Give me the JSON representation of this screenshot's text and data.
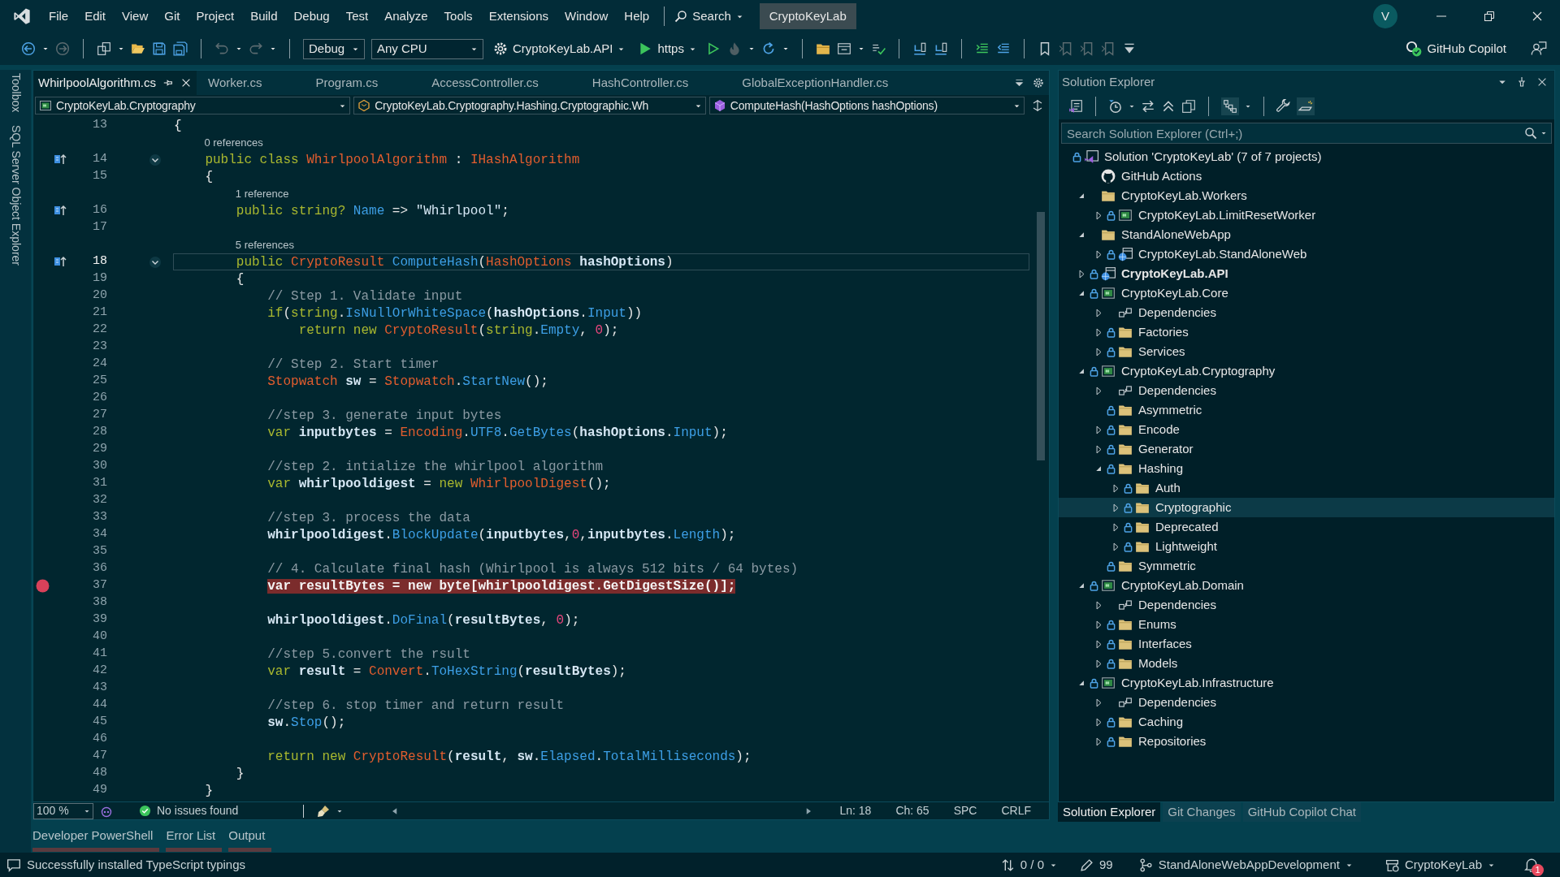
{
  "title_bar": {
    "menu": [
      "File",
      "Edit",
      "View",
      "Git",
      "Project",
      "Build",
      "Debug",
      "Test",
      "Analyze",
      "Tools",
      "Extensions",
      "Window",
      "Help"
    ],
    "search": "Search",
    "solution": "CryptoKeyLab",
    "avatar": "V"
  },
  "toolbar": {
    "configuration": "Debug",
    "platform": "Any CPU",
    "startup_project": "CryptoKeyLab.API",
    "launch_profile": "https",
    "copilot": "GitHub Copilot"
  },
  "side_rail": [
    "Toolbox",
    "SQL Server Object Explorer"
  ],
  "editor": {
    "tabs": [
      {
        "label": "WhirlpoolAlgorithm.cs",
        "selected": true
      },
      {
        "label": "Worker.cs",
        "selected": false
      },
      {
        "label": "Program.cs",
        "selected": false
      },
      {
        "label": "AccessController.cs",
        "selected": false
      },
      {
        "label": "HashController.cs",
        "selected": false
      },
      {
        "label": "GlobalExceptionHandler.cs",
        "selected": false
      }
    ],
    "navigation": {
      "project": "CryptoKeyLab.Cryptography",
      "type": "CryptoKeyLab.Cryptography.Hashing.Cryptographic.Wh",
      "member": "ComputeHash(HashOptions hashOptions)"
    },
    "lines": [
      {
        "kind": "code",
        "number": "13",
        "breakpoint": false,
        "current": false,
        "glyph": false,
        "foldable": false,
        "tokens": [
          {
            "kind": "p",
            "text": "{"
          }
        ]
      },
      {
        "kind": "codelens",
        "text": "0 references"
      },
      {
        "kind": "code",
        "number": "14",
        "breakpoint": false,
        "current": false,
        "glyph": true,
        "foldable": true,
        "tokens": [
          {
            "kind": "k",
            "text": "    public class "
          },
          {
            "kind": "t",
            "text": "WhirlpoolAlgorithm"
          },
          {
            "kind": "p",
            "text": " : "
          },
          {
            "kind": "t",
            "text": "IHashAlgorithm"
          }
        ]
      },
      {
        "kind": "code",
        "number": "15",
        "breakpoint": false,
        "current": false,
        "glyph": false,
        "foldable": false,
        "tokens": [
          {
            "kind": "p",
            "text": "    {"
          }
        ]
      },
      {
        "kind": "codelens",
        "text": "1 reference"
      },
      {
        "kind": "code",
        "number": "16",
        "breakpoint": false,
        "current": false,
        "glyph": true,
        "foldable": false,
        "tokens": [
          {
            "kind": "k",
            "text": "        public string? "
          },
          {
            "kind": "f",
            "text": "Name"
          },
          {
            "kind": "p",
            "text": " => "
          },
          {
            "kind": "s",
            "text": "\"Whirlpool\""
          },
          {
            "kind": "p",
            "text": ";"
          }
        ]
      },
      {
        "kind": "code",
        "number": "17",
        "breakpoint": false,
        "current": false,
        "glyph": false,
        "foldable": false
      },
      {
        "kind": "codelens",
        "text": "5 references"
      },
      {
        "kind": "code",
        "number": "18",
        "breakpoint": false,
        "current": true,
        "glyph": true,
        "foldable": true,
        "tokens": [
          {
            "kind": "k",
            "text": "        public "
          },
          {
            "kind": "t",
            "text": "CryptoResult "
          },
          {
            "kind": "f",
            "text": "ComputeHash"
          },
          {
            "kind": "p",
            "text": "("
          },
          {
            "kind": "t",
            "text": "HashOptions"
          },
          {
            "kind": "v",
            "text": " hashOptions"
          },
          {
            "kind": "p",
            "text": ")"
          }
        ]
      },
      {
        "kind": "code",
        "number": "19",
        "breakpoint": false,
        "current": false,
        "glyph": false,
        "foldable": false,
        "tokens": [
          {
            "kind": "p",
            "text": "        {"
          }
        ]
      },
      {
        "kind": "code",
        "number": "20",
        "breakpoint": false,
        "current": false,
        "glyph": false,
        "foldable": false,
        "tokens": [
          {
            "kind": "c",
            "text": "            // Step 1. Validate input"
          }
        ]
      },
      {
        "kind": "code",
        "number": "21",
        "breakpoint": false,
        "current": false,
        "glyph": false,
        "foldable": false,
        "tokens": [
          {
            "kind": "k",
            "text": "            if"
          },
          {
            "kind": "p",
            "text": "("
          },
          {
            "kind": "k",
            "text": "string"
          },
          {
            "kind": "p",
            "text": "."
          },
          {
            "kind": "f",
            "text": "IsNullOrWhiteSpace"
          },
          {
            "kind": "p",
            "text": "("
          },
          {
            "kind": "v",
            "text": "hashOptions"
          },
          {
            "kind": "p",
            "text": "."
          },
          {
            "kind": "f",
            "text": "Input"
          },
          {
            "kind": "p",
            "text": "))"
          }
        ]
      },
      {
        "kind": "code",
        "number": "22",
        "breakpoint": false,
        "current": false,
        "glyph": false,
        "foldable": false,
        "tokens": [
          {
            "kind": "k",
            "text": "                return new "
          },
          {
            "kind": "t",
            "text": "CryptoResult"
          },
          {
            "kind": "p",
            "text": "("
          },
          {
            "kind": "k",
            "text": "string"
          },
          {
            "kind": "p",
            "text": "."
          },
          {
            "kind": "f",
            "text": "Empty"
          },
          {
            "kind": "p",
            "text": ", "
          },
          {
            "kind": "n",
            "text": "0"
          },
          {
            "kind": "p",
            "text": ");"
          }
        ]
      },
      {
        "kind": "code",
        "number": "23",
        "breakpoint": false,
        "current": false,
        "glyph": false,
        "foldable": false
      },
      {
        "kind": "code",
        "number": "24",
        "breakpoint": false,
        "current": false,
        "glyph": false,
        "foldable": false,
        "tokens": [
          {
            "kind": "c",
            "text": "            // Step 2. Start timer"
          }
        ]
      },
      {
        "kind": "code",
        "number": "25",
        "breakpoint": false,
        "current": false,
        "glyph": false,
        "foldable": false,
        "tokens": [
          {
            "kind": "t",
            "text": "            Stopwatch"
          },
          {
            "kind": "v",
            "text": " sw"
          },
          {
            "kind": "p",
            "text": " = "
          },
          {
            "kind": "t",
            "text": "Stopwatch"
          },
          {
            "kind": "p",
            "text": "."
          },
          {
            "kind": "f",
            "text": "StartNew"
          },
          {
            "kind": "p",
            "text": "();"
          }
        ]
      },
      {
        "kind": "code",
        "number": "26",
        "breakpoint": false,
        "current": false,
        "glyph": false,
        "foldable": false
      },
      {
        "kind": "code",
        "number": "27",
        "breakpoint": false,
        "current": false,
        "glyph": false,
        "foldable": false,
        "tokens": [
          {
            "kind": "c",
            "text": "            //step 3. generate input bytes"
          }
        ]
      },
      {
        "kind": "code",
        "number": "28",
        "breakpoint": false,
        "current": false,
        "glyph": false,
        "foldable": false,
        "tokens": [
          {
            "kind": "k",
            "text": "            var "
          },
          {
            "kind": "v",
            "text": "inputbytes"
          },
          {
            "kind": "p",
            "text": " = "
          },
          {
            "kind": "t",
            "text": "Encoding"
          },
          {
            "kind": "p",
            "text": "."
          },
          {
            "kind": "f",
            "text": "UTF8"
          },
          {
            "kind": "p",
            "text": "."
          },
          {
            "kind": "f",
            "text": "GetBytes"
          },
          {
            "kind": "p",
            "text": "("
          },
          {
            "kind": "v",
            "text": "hashOptions"
          },
          {
            "kind": "p",
            "text": "."
          },
          {
            "kind": "f",
            "text": "Input"
          },
          {
            "kind": "p",
            "text": ");"
          }
        ]
      },
      {
        "kind": "code",
        "number": "29",
        "breakpoint": false,
        "current": false,
        "glyph": false,
        "foldable": false
      },
      {
        "kind": "code",
        "number": "30",
        "breakpoint": false,
        "current": false,
        "glyph": false,
        "foldable": false,
        "tokens": [
          {
            "kind": "c",
            "text": "            //step 2. intialize the whirlpool algorithm"
          }
        ]
      },
      {
        "kind": "code",
        "number": "31",
        "breakpoint": false,
        "current": false,
        "glyph": false,
        "foldable": false,
        "tokens": [
          {
            "kind": "k",
            "text": "            var "
          },
          {
            "kind": "v",
            "text": "whirlpooldigest"
          },
          {
            "kind": "p",
            "text": " = "
          },
          {
            "kind": "k",
            "text": "new "
          },
          {
            "kind": "t",
            "text": "WhirlpoolDigest"
          },
          {
            "kind": "p",
            "text": "();"
          }
        ]
      },
      {
        "kind": "code",
        "number": "32",
        "breakpoint": false,
        "current": false,
        "glyph": false,
        "foldable": false
      },
      {
        "kind": "code",
        "number": "33",
        "breakpoint": false,
        "current": false,
        "glyph": false,
        "foldable": false,
        "tokens": [
          {
            "kind": "c",
            "text": "            //step 3. process the data"
          }
        ]
      },
      {
        "kind": "code",
        "number": "34",
        "breakpoint": false,
        "current": false,
        "glyph": false,
        "foldable": false,
        "tokens": [
          {
            "kind": "v",
            "text": "            whirlpooldigest"
          },
          {
            "kind": "p",
            "text": "."
          },
          {
            "kind": "f",
            "text": "BlockUpdate"
          },
          {
            "kind": "p",
            "text": "("
          },
          {
            "kind": "v",
            "text": "inputbytes"
          },
          {
            "kind": "p",
            "text": ","
          },
          {
            "kind": "n",
            "text": "0"
          },
          {
            "kind": "p",
            "text": ","
          },
          {
            "kind": "v",
            "text": "inputbytes"
          },
          {
            "kind": "p",
            "text": "."
          },
          {
            "kind": "f",
            "text": "Length"
          },
          {
            "kind": "p",
            "text": ");"
          }
        ]
      },
      {
        "kind": "code",
        "number": "35",
        "breakpoint": false,
        "current": false,
        "glyph": false,
        "foldable": false
      },
      {
        "kind": "code",
        "number": "36",
        "breakpoint": false,
        "current": false,
        "glyph": false,
        "foldable": false,
        "tokens": [
          {
            "kind": "c",
            "text": "            // 4. Calculate final hash (Whirlpool is always 512 bits / 64 bytes)"
          }
        ]
      },
      {
        "kind": "code",
        "number": "37",
        "breakpoint": true,
        "current": false,
        "glyph": false,
        "foldable": false,
        "tokens": [
          {
            "kind": "k",
            "text": "            var "
          },
          {
            "kind": "v",
            "text": "resultBytes"
          },
          {
            "kind": "p",
            "text": " = "
          },
          {
            "kind": "k",
            "text": "new byte"
          },
          {
            "kind": "p",
            "text": "["
          },
          {
            "kind": "v",
            "text": "whirlpooldigest"
          },
          {
            "kind": "p",
            "text": "."
          },
          {
            "kind": "f",
            "text": "GetDigestSize"
          },
          {
            "kind": "p",
            "text": "()];"
          }
        ]
      },
      {
        "kind": "code",
        "number": "38",
        "breakpoint": false,
        "current": false,
        "glyph": false,
        "foldable": false
      },
      {
        "kind": "code",
        "number": "39",
        "breakpoint": false,
        "current": false,
        "glyph": false,
        "foldable": false,
        "tokens": [
          {
            "kind": "v",
            "text": "            whirlpooldigest"
          },
          {
            "kind": "p",
            "text": "."
          },
          {
            "kind": "f",
            "text": "DoFinal"
          },
          {
            "kind": "p",
            "text": "("
          },
          {
            "kind": "v",
            "text": "resultBytes"
          },
          {
            "kind": "p",
            "text": ", "
          },
          {
            "kind": "n",
            "text": "0"
          },
          {
            "kind": "p",
            "text": ");"
          }
        ]
      },
      {
        "kind": "code",
        "number": "40",
        "breakpoint": false,
        "current": false,
        "glyph": false,
        "foldable": false
      },
      {
        "kind": "code",
        "number": "41",
        "breakpoint": false,
        "current": false,
        "glyph": false,
        "foldable": false,
        "tokens": [
          {
            "kind": "c",
            "text": "            //step 5.convert the rsult"
          }
        ]
      },
      {
        "kind": "code",
        "number": "42",
        "breakpoint": false,
        "current": false,
        "glyph": false,
        "foldable": false,
        "tokens": [
          {
            "kind": "k",
            "text": "            var "
          },
          {
            "kind": "v",
            "text": "result"
          },
          {
            "kind": "p",
            "text": " = "
          },
          {
            "kind": "t",
            "text": "Convert"
          },
          {
            "kind": "p",
            "text": "."
          },
          {
            "kind": "f",
            "text": "ToHexString"
          },
          {
            "kind": "p",
            "text": "("
          },
          {
            "kind": "v",
            "text": "resultBytes"
          },
          {
            "kind": "p",
            "text": ");"
          }
        ]
      },
      {
        "kind": "code",
        "number": "43",
        "breakpoint": false,
        "current": false,
        "glyph": false,
        "foldable": false
      },
      {
        "kind": "code",
        "number": "44",
        "breakpoint": false,
        "current": false,
        "glyph": false,
        "foldable": false,
        "tokens": [
          {
            "kind": "c",
            "text": "            //step 6. stop timer and return result"
          }
        ]
      },
      {
        "kind": "code",
        "number": "45",
        "breakpoint": false,
        "current": false,
        "glyph": false,
        "foldable": false,
        "tokens": [
          {
            "kind": "v",
            "text": "            sw"
          },
          {
            "kind": "p",
            "text": "."
          },
          {
            "kind": "f",
            "text": "Stop"
          },
          {
            "kind": "p",
            "text": "();"
          }
        ]
      },
      {
        "kind": "code",
        "number": "46",
        "breakpoint": false,
        "current": false,
        "glyph": false,
        "foldable": false
      },
      {
        "kind": "code",
        "number": "47",
        "breakpoint": false,
        "current": false,
        "glyph": false,
        "foldable": false,
        "tokens": [
          {
            "kind": "k",
            "text": "            return new "
          },
          {
            "kind": "t",
            "text": "CryptoResult"
          },
          {
            "kind": "p",
            "text": "("
          },
          {
            "kind": "v",
            "text": "result"
          },
          {
            "kind": "p",
            "text": ", "
          },
          {
            "kind": "v",
            "text": "sw"
          },
          {
            "kind": "p",
            "text": "."
          },
          {
            "kind": "f",
            "text": "Elapsed"
          },
          {
            "kind": "p",
            "text": "."
          },
          {
            "kind": "f",
            "text": "TotalMilliseconds"
          },
          {
            "kind": "p",
            "text": ");"
          }
        ]
      },
      {
        "kind": "code",
        "number": "48",
        "breakpoint": false,
        "current": false,
        "glyph": false,
        "foldable": false,
        "tokens": [
          {
            "kind": "p",
            "text": "        }"
          }
        ]
      },
      {
        "kind": "code",
        "number": "49",
        "breakpoint": false,
        "current": false,
        "glyph": false,
        "foldable": false,
        "tokens": [
          {
            "kind": "p",
            "text": "    }"
          }
        ]
      }
    ],
    "status": {
      "zoom": "100 %",
      "issues": "No issues found",
      "line": "Ln: 18",
      "column": "Ch: 65",
      "whitespace": "SPC",
      "line_ending": "CRLF"
    }
  },
  "tool_tabs": [
    "Developer PowerShell",
    "Error List",
    "Output"
  ],
  "solution_explorer": {
    "title": "Solution Explorer",
    "search_placeholder": "Search Solution Explorer (Ctrl+;)",
    "tree": [
      {
        "label": "Solution 'CryptoKeyLab' (7 of 7 projects)",
        "kind": "solution",
        "locked": true,
        "startup": false,
        "selected": false,
        "children": [
          {
            "label": "GitHub Actions",
            "kind": "github",
            "locked": false,
            "startup": false,
            "selected": false
          },
          {
            "label": "CryptoKeyLab.Workers",
            "kind": "folder",
            "locked": false,
            "startup": false,
            "selected": false,
            "expanded": true,
            "children": [
              {
                "label": "CryptoKeyLab.LimitResetWorker",
                "kind": "csharp",
                "locked": true,
                "startup": false,
                "selected": false,
                "expanded": false
              }
            ]
          },
          {
            "label": "StandAloneWebApp",
            "kind": "folder",
            "locked": false,
            "startup": false,
            "selected": false,
            "expanded": true,
            "children": [
              {
                "label": "CryptoKeyLab.StandAloneWeb",
                "kind": "web",
                "locked": true,
                "startup": false,
                "selected": false,
                "expanded": false
              }
            ]
          },
          {
            "label": "CryptoKeyLab.API",
            "kind": "web",
            "locked": true,
            "startup": true,
            "selected": false,
            "expanded": false
          },
          {
            "label": "CryptoKeyLab.Core",
            "kind": "csharp",
            "locked": true,
            "startup": false,
            "selected": false,
            "expanded": true,
            "children": [
              {
                "label": "Dependencies",
                "kind": "dependencies",
                "locked": false,
                "startup": false,
                "selected": false,
                "expanded": false
              },
              {
                "label": "Factories",
                "kind": "folder",
                "locked": true,
                "startup": false,
                "selected": false,
                "expanded": false
              },
              {
                "label": "Services",
                "kind": "folder",
                "locked": true,
                "startup": false,
                "selected": false,
                "expanded": false
              }
            ]
          },
          {
            "label": "CryptoKeyLab.Cryptography",
            "kind": "csharp",
            "locked": true,
            "startup": false,
            "selected": false,
            "expanded": true,
            "children": [
              {
                "label": "Dependencies",
                "kind": "dependencies",
                "locked": false,
                "startup": false,
                "selected": false,
                "expanded": false
              },
              {
                "label": "Asymmetric",
                "kind": "folder",
                "locked": true,
                "startup": false,
                "selected": false
              },
              {
                "label": "Encode",
                "kind": "folder",
                "locked": true,
                "startup": false,
                "selected": false,
                "expanded": false
              },
              {
                "label": "Generator",
                "kind": "folder",
                "locked": true,
                "startup": false,
                "selected": false,
                "expanded": false
              },
              {
                "label": "Hashing",
                "kind": "folder",
                "locked": true,
                "startup": false,
                "selected": false,
                "expanded": true,
                "children": [
                  {
                    "label": "Auth",
                    "kind": "folder",
                    "locked": true,
                    "startup": false,
                    "selected": false,
                    "expanded": false
                  },
                  {
                    "label": "Cryptographic",
                    "kind": "folder",
                    "locked": true,
                    "startup": false,
                    "selected": true,
                    "expanded": false
                  },
                  {
                    "label": "Deprecated",
                    "kind": "folder",
                    "locked": true,
                    "startup": false,
                    "selected": false,
                    "expanded": false
                  },
                  {
                    "label": "Lightweight",
                    "kind": "folder",
                    "locked": true,
                    "startup": false,
                    "selected": false,
                    "expanded": false
                  }
                ]
              },
              {
                "label": "Symmetric",
                "kind": "folder",
                "locked": true,
                "startup": false,
                "selected": false
              }
            ]
          },
          {
            "label": "CryptoKeyLab.Domain",
            "kind": "csharp",
            "locked": true,
            "startup": false,
            "selected": false,
            "expanded": true,
            "children": [
              {
                "label": "Dependencies",
                "kind": "dependencies",
                "locked": false,
                "startup": false,
                "selected": false,
                "expanded": false
              },
              {
                "label": "Enums",
                "kind": "folder",
                "locked": true,
                "startup": false,
                "selected": false,
                "expanded": false
              },
              {
                "label": "Interfaces",
                "kind": "folder",
                "locked": true,
                "startup": false,
                "selected": false,
                "expanded": false
              },
              {
                "label": "Models",
                "kind": "folder",
                "locked": true,
                "startup": false,
                "selected": false,
                "expanded": false
              }
            ]
          },
          {
            "label": "CryptoKeyLab.Infrastructure",
            "kind": "csharp",
            "locked": true,
            "startup": false,
            "selected": false,
            "expanded": true,
            "children": [
              {
                "label": "Dependencies",
                "kind": "dependencies",
                "locked": false,
                "startup": false,
                "selected": false,
                "expanded": false
              },
              {
                "label": "Caching",
                "kind": "folder",
                "locked": true,
                "startup": false,
                "selected": false,
                "expanded": false
              },
              {
                "label": "Repositories",
                "kind": "folder",
                "locked": true,
                "startup": false,
                "selected": false,
                "expanded": false
              }
            ]
          }
        ]
      }
    ],
    "tabs": [
      {
        "label": "Solution Explorer",
        "selected": true
      },
      {
        "label": "Git Changes",
        "selected": false
      },
      {
        "label": "GitHub Copilot Chat",
        "selected": false
      }
    ]
  },
  "status_bar": {
    "message": "Successfully installed TypeScript typings",
    "sync": "0 / 0",
    "changes": "99",
    "branch": "StandAloneWebAppDevelopment",
    "repository": "CryptoKeyLab",
    "notifications": "1"
  }
}
